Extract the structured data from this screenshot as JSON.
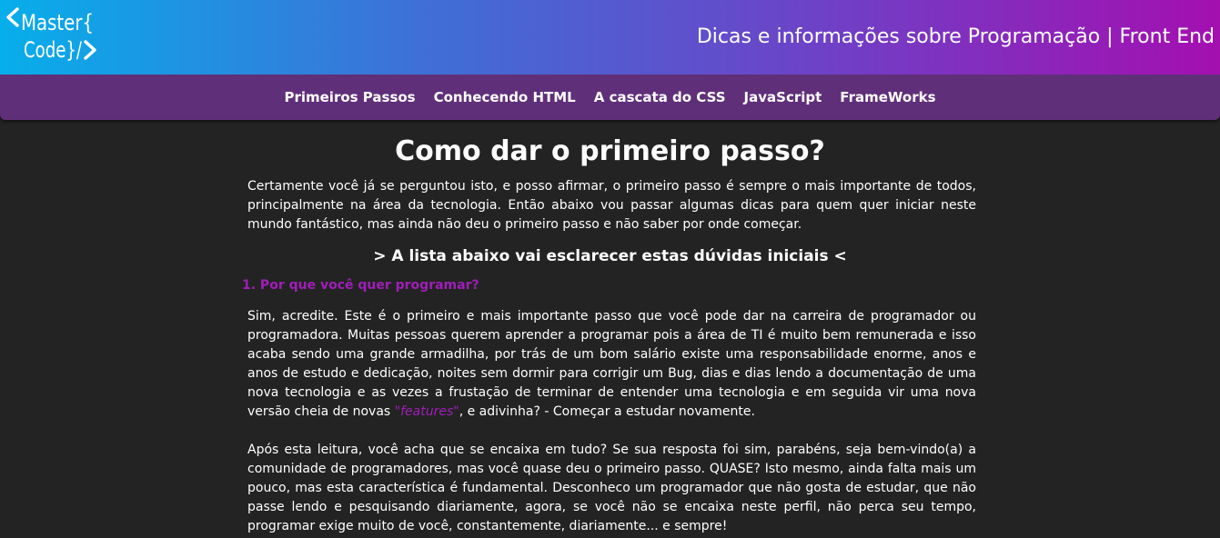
{
  "header": {
    "logo_text": "<Master{ Code}/>",
    "site_title": "Dicas e informações sobre Programação | Front End",
    "brand_colors": {
      "gradient_start": "#07aeea",
      "gradient_end": "#a40fb0",
      "nav_background": "#602f79",
      "accent": "#a01eb8"
    }
  },
  "nav": {
    "items": [
      {
        "label": "Primeiros Passos"
      },
      {
        "label": "Conhecendo HTML"
      },
      {
        "label": "A cascata do CSS"
      },
      {
        "label": "JavaScript"
      },
      {
        "label": "FrameWorks"
      }
    ]
  },
  "article": {
    "title": "Como dar o primeiro passo?",
    "intro": "Certamente você já se perguntou isto, e posso afirmar, o primeiro passo é sempre o mais importante de todos, principalmente na área da tecnologia. Então abaixo vou passar algumas dicas para quem quer iniciar neste mundo fantástico, mas ainda não deu o primeiro passo e não saber por onde começar.",
    "subtitle": "> A lista abaixo vai esclarecer estas dúvidas iniciais <",
    "section1": {
      "heading": "1. Por que você quer programar?",
      "p1_before": "Sim, acredite. Este é o primeiro e mais importante passo que você pode dar na carreira de programador ou programadora. Muitas pessoas querem aprender a programar pois a área de TI é muito bem remunerada e isso acaba sendo uma grande armadilha, por trás de um bom salário existe uma responsabilidade enorme, anos e anos de estudo e dedicação, noites sem dormir para corrigir um Bug, dias e dias lendo a documentação de uma nova tecnologia e as vezes a frustação de terminar de entender uma tecnologia e em seguida vir uma nova versão cheia de novas ",
      "p1_highlight": "\"features\"",
      "p1_after": ", e adivinha? - Começar a estudar novamente.",
      "p2": "Após esta leitura, você acha que se encaixa em tudo? Se sua resposta foi sim, parabéns, seja bem-vindo(a) a comunidade de programadores, mas você quase deu o primeiro passo. QUASE? Isto mesmo, ainda falta mais um pouco, mas esta característica é fundamental. Desconheco um programador que não gosta de estudar, que não passe lendo e pesquisando diariamente, agora, se você não se encaixa neste perfil, não perca seu tempo, programar exige muito de você, constantemente, diariamente... e sempre!"
    }
  }
}
